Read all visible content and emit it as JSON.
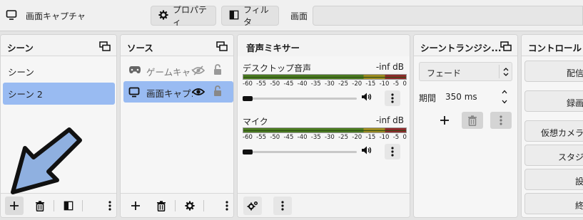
{
  "toolbar": {
    "title": "画面キャプチャ",
    "properties_label": "プロパティ",
    "filters_label": "フィルタ",
    "scene_field_label": "画面"
  },
  "scenes": {
    "title": "シーン",
    "items": [
      {
        "label": "シーン",
        "selected": false
      },
      {
        "label": "シーン 2",
        "selected": true
      }
    ]
  },
  "sources": {
    "title": "ソース",
    "items": [
      {
        "label": "ゲームキャプ",
        "icon": "gamepad-icon",
        "visible": false,
        "locked": false,
        "selected": false
      },
      {
        "label": "画面キャプ:",
        "icon": "monitor-icon",
        "visible": true,
        "locked": false,
        "selected": true
      }
    ]
  },
  "mixer": {
    "title": "音声ミキサー",
    "ticks": [
      "-60",
      "-55",
      "-50",
      "-45",
      "-40",
      "-35",
      "-30",
      "-25",
      "-20",
      "-15",
      "-10",
      "-5",
      "0"
    ],
    "channels": [
      {
        "name": "デスクトップ音声",
        "level": "-inf dB"
      },
      {
        "name": "マイク",
        "level": "-inf dB"
      }
    ]
  },
  "transitions": {
    "title": "シーントランジシ...",
    "selected": "フェード",
    "duration_label": "期間",
    "duration_value": "350 ms"
  },
  "controls": {
    "title": "コントロール",
    "buttons": [
      "配信開",
      "録画開",
      "仮想カメラ開",
      "スタジオ",
      "設定",
      "終了"
    ]
  },
  "colors": {
    "accent": "#99bbf2",
    "arrow_fill": "#8fb0e0",
    "meter_green": "#4a7a20",
    "meter_yellow": "#9c8a20",
    "meter_red": "#8c2b2b"
  }
}
